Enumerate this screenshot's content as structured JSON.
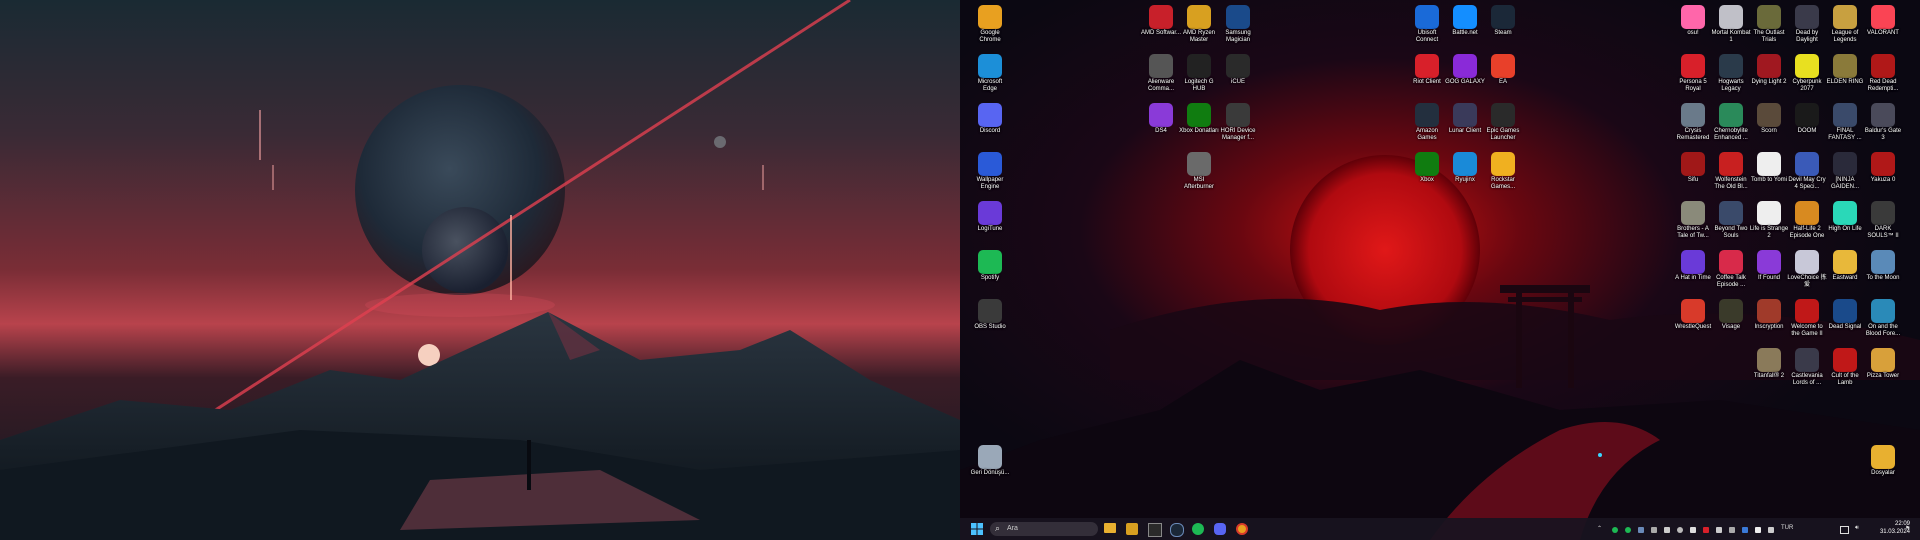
{
  "left_monitor": {
    "wallpaper": "planet-mountain-red-sky"
  },
  "right_monitor": {
    "wallpaper": "red-moon-torii-gate"
  },
  "colors": {
    "accent": "#d0323c",
    "taskbar": "#181420"
  },
  "desktop_icons": [
    {
      "label": "Google Chrome",
      "icon": "chrome-icon",
      "color": "#e8a020"
    },
    {
      "label": "Microsoft Edge",
      "icon": "edge-icon",
      "color": "#1c8fd8"
    },
    {
      "label": "Discord",
      "icon": "discord-icon",
      "color": "#5865f2"
    },
    {
      "label": "Wallpaper Engine",
      "icon": "wallpaper-engine-icon",
      "color": "#2a5ad8"
    },
    {
      "label": "LogiTune",
      "icon": "logitune-icon",
      "color": "#6a3ad8"
    },
    {
      "label": "Spotify",
      "icon": "spotify-icon",
      "color": "#1db954"
    },
    {
      "label": "OBS Studio",
      "icon": "obs-icon",
      "color": "#3a3a3a"
    },
    {
      "label": "Geri Dönüşü...",
      "icon": "recycle-bin-icon",
      "color": "#9aa8b8"
    },
    {
      "label": "AMD Softwar...",
      "icon": "amd-icon",
      "color": "#c8202a"
    },
    {
      "label": "AMD Ryzen Master",
      "icon": "ryzen-master-icon",
      "color": "#d8a020"
    },
    {
      "label": "Samsung Magician",
      "icon": "samsung-magician-icon",
      "color": "#1a4a8a"
    },
    {
      "label": "Alienware Comma...",
      "icon": "alienware-icon",
      "color": "#555555"
    },
    {
      "label": "Logitech G HUB",
      "icon": "ghub-icon",
      "color": "#222222"
    },
    {
      "label": "iCUE",
      "icon": "icue-icon",
      "color": "#2a2a2a"
    },
    {
      "label": "DS4",
      "icon": "ds4-icon",
      "color": "#8a3ad8"
    },
    {
      "label": "Xbox Donatları",
      "icon": "xbox-accessories-icon",
      "color": "#107c10"
    },
    {
      "label": "HORI Device Manager f...",
      "icon": "hori-icon",
      "color": "#3a3a3a"
    },
    {
      "label": "MSI Afterburner",
      "icon": "msi-afterburner-icon",
      "color": "#6a6a6a"
    },
    {
      "label": "Ubisoft Connect",
      "icon": "ubisoft-icon",
      "color": "#1a6ad8"
    },
    {
      "label": "Battle.net",
      "icon": "battlenet-icon",
      "color": "#148eff"
    },
    {
      "label": "Steam",
      "icon": "steam-icon",
      "color": "#1b2838"
    },
    {
      "label": "Riot Client",
      "icon": "riot-icon",
      "color": "#d8202a"
    },
    {
      "label": "GOG GALAXY",
      "icon": "gog-icon",
      "color": "#8a2ad8"
    },
    {
      "label": "EA",
      "icon": "ea-icon",
      "color": "#e8402a"
    },
    {
      "label": "Amazon Games",
      "icon": "amazon-games-icon",
      "color": "#232f3e"
    },
    {
      "label": "Lunar Client",
      "icon": "lunar-icon",
      "color": "#3a3a5a"
    },
    {
      "label": "Epic Games Launcher",
      "icon": "epic-icon",
      "color": "#2a2a2a"
    },
    {
      "label": "Xbox",
      "icon": "xbox-icon",
      "color": "#107c10"
    },
    {
      "label": "Ryujinx",
      "icon": "ryujinx-icon",
      "color": "#1a8ad8"
    },
    {
      "label": "Rockstar Games...",
      "icon": "rockstar-icon",
      "color": "#f0b020"
    },
    {
      "label": "osu!",
      "icon": "osu-icon",
      "color": "#ff66aa"
    },
    {
      "label": "Mortal Kombat 1",
      "icon": "mk1-icon",
      "color": "#c0c0c8"
    },
    {
      "label": "The Outlast Trials",
      "icon": "outlast-icon",
      "color": "#6a6a3a"
    },
    {
      "label": "Dead by Daylight",
      "icon": "dbd-icon",
      "color": "#3a3a4a"
    },
    {
      "label": "League of Legends",
      "icon": "lol-icon",
      "color": "#c8a040"
    },
    {
      "label": "VALORANT",
      "icon": "valorant-icon",
      "color": "#fa4454"
    },
    {
      "label": "Persona 5 Royal",
      "icon": "p5r-icon",
      "color": "#d8202a"
    },
    {
      "label": "Hogwarts Legacy",
      "icon": "hogwarts-icon",
      "color": "#2a3a4a"
    },
    {
      "label": "Dying Light 2",
      "icon": "dl2-icon",
      "color": "#a01820"
    },
    {
      "label": "Cyberpunk 2077",
      "icon": "cyberpunk-icon",
      "color": "#e8e020"
    },
    {
      "label": "ELDEN RING",
      "icon": "elden-ring-icon",
      "color": "#8a7a3a"
    },
    {
      "label": "Red Dead Redempti...",
      "icon": "rdr2-icon",
      "color": "#b01818"
    },
    {
      "label": "Crysis Remastered",
      "icon": "crysis-icon",
      "color": "#6a7a8a"
    },
    {
      "label": "Chernobylite Enhanced ...",
      "icon": "chernobylite-icon",
      "color": "#2a8a5a"
    },
    {
      "label": "Scorn",
      "icon": "scorn-icon",
      "color": "#5a4a3a"
    },
    {
      "label": "DOOM",
      "icon": "doom-icon",
      "color": "#1a1a1a"
    },
    {
      "label": "FINAL FANTASY ...",
      "icon": "ff-icon",
      "color": "#3a4a6a"
    },
    {
      "label": "Baldur's Gate 3",
      "icon": "bg3-icon",
      "color": "#4a4a5a"
    },
    {
      "label": "Sifu",
      "icon": "sifu-icon",
      "color": "#a01818"
    },
    {
      "label": "Wolfenstein The Old Bl...",
      "icon": "wolfenstein-icon",
      "color": "#c82020"
    },
    {
      "label": "Tomb to Yomi",
      "icon": "yomi-icon",
      "color": "#eeeeee"
    },
    {
      "label": "Devil May Cry 4 Speci...",
      "icon": "dmc4-icon",
      "color": "#3a5ab8"
    },
    {
      "label": "[NINJA GAIDEN...",
      "icon": "ninja-gaiden-icon",
      "color": "#2a2a3a"
    },
    {
      "label": "Yakuza 0",
      "icon": "yakuza-icon",
      "color": "#b01818"
    },
    {
      "label": "Brothers - A Tale of Tw...",
      "icon": "brothers-icon",
      "color": "#8a8a7a"
    },
    {
      "label": "Beyond Two Souls",
      "icon": "beyond-icon",
      "color": "#3a4a6a"
    },
    {
      "label": "Life is Strange 2",
      "icon": "lis2-icon",
      "color": "#eeeeee"
    },
    {
      "label": "Half-Life 2 Episode One",
      "icon": "hl2-icon",
      "color": "#d88a20"
    },
    {
      "label": "High On Life",
      "icon": "high-on-life-icon",
      "color": "#2ad8b8"
    },
    {
      "label": "DARK SOULS™ II",
      "icon": "ds2-icon",
      "color": "#3a3a3a"
    },
    {
      "label": "A Hat in Time",
      "icon": "hat-in-time-icon",
      "color": "#6a3ad8"
    },
    {
      "label": "Coffee Talk Episode ...",
      "icon": "coffee-talk-icon",
      "color": "#d82a4a"
    },
    {
      "label": "If Found",
      "icon": "if-found-icon",
      "color": "#8a3ad8"
    },
    {
      "label": "LoveChoice 拣爱",
      "icon": "lovechoice-icon",
      "color": "#c8c8d8"
    },
    {
      "label": "Eastward",
      "icon": "eastward-icon",
      "color": "#e8b83a"
    },
    {
      "label": "To the Moon",
      "icon": "to-the-moon-icon",
      "color": "#5a8ab8"
    },
    {
      "label": "WrestleQuest",
      "icon": "wrestlequest-icon",
      "color": "#d83a2a"
    },
    {
      "label": "Visage",
      "icon": "visage-icon",
      "color": "#3a3a2a"
    },
    {
      "label": "Inscryption",
      "icon": "inscryption-icon",
      "color": "#a03a2a"
    },
    {
      "label": "Welcome to the Game II",
      "icon": "wttg2-icon",
      "color": "#c01818"
    },
    {
      "label": "Dead Signal",
      "icon": "dead-signal-icon",
      "color": "#1a4a8a"
    },
    {
      "label": "On and the Blood Fore...",
      "icon": "on-blood-icon",
      "color": "#2a8ab8"
    },
    {
      "label": "Titanfall® 2",
      "icon": "titanfall-icon",
      "color": "#8a7a5a"
    },
    {
      "label": "Castlevania Lords of ...",
      "icon": "castlevania-icon",
      "color": "#3a3a4a"
    },
    {
      "label": "Cult of the Lamb",
      "icon": "cult-lamb-icon",
      "color": "#c01818"
    },
    {
      "label": "Pizza Tower",
      "icon": "pizza-tower-icon",
      "color": "#d8a03a"
    },
    {
      "label": "Dosyalar",
      "icon": "folder-icon",
      "color": "#e8b030"
    }
  ],
  "taskbar": {
    "search_placeholder": "Ara",
    "tray_lang": "TUR",
    "time": "22:09",
    "date": "31.03.2024"
  }
}
